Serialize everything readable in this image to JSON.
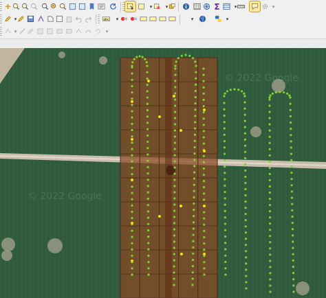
{
  "app": "QGIS",
  "toolbar": {
    "sum_symbol": "Σ",
    "row1": [
      "pan-icon",
      "zoom-in-icon",
      "zoom-out-icon",
      "zoom-full-icon",
      "zoom-selection-icon",
      "zoom-layer-icon",
      "zoom-native-icon",
      "zoom-last-icon",
      "zoom-next-icon",
      "new-bookmark-icon",
      "show-bookmarks-icon",
      "refresh-icon",
      "select-features-icon",
      "select-by-value-icon",
      "deselect-icon",
      "select-location-icon",
      "identify-icon",
      "attribute-table-icon",
      "field-calculator-icon",
      "statistics-icon",
      "open-table-icon",
      "measure-icon",
      "annotation-icon",
      "settings-icon"
    ],
    "row2": [
      "current-edits-icon",
      "toggle-editing-icon",
      "save-edits-icon",
      "digitize-icon",
      "add-feature-icon",
      "move-feature-icon",
      "delete-icon",
      "cut-icon",
      "copy-icon",
      "paste-icon",
      "undo-icon",
      "redo-icon",
      "label-icon",
      "label-pin-icon",
      "label-show-icon",
      "label-move-icon",
      "python-icon",
      "globe-icon"
    ],
    "row3": [
      "node-tool-icon",
      "simplify-icon",
      "add-ring-icon",
      "add-part-icon",
      "fill-ring-icon",
      "delete-ring-icon",
      "delete-part-icon",
      "reshape-icon",
      "offset-curve-icon",
      "split-icon",
      "merge-icon",
      "rotate-icon"
    ]
  },
  "map": {
    "watermark": "© 2022 Google",
    "colors": {
      "crop": "#2f5a3b",
      "road": "#c9beae",
      "grid_fill": "#8a4a22",
      "grid_line": "#4a2a14",
      "track_point": "#7fd22f",
      "highlight_point": "#f2e600"
    },
    "grid": {
      "columns": 5,
      "rows": 10
    },
    "tracks": 6
  }
}
